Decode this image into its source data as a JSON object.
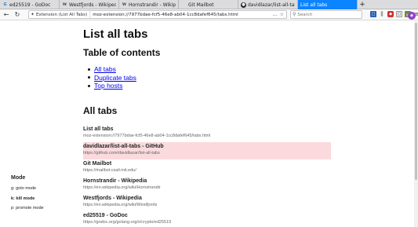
{
  "browser": {
    "tabs": [
      {
        "label": "ed25519 - GoDoc",
        "icon": "godoc-favicon-icon",
        "active": false
      },
      {
        "label": "Westfjords - Wikipedia",
        "icon": "wikipedia-favicon-icon",
        "active": false
      },
      {
        "label": "Hornstrandir - Wikipedia",
        "icon": "wikipedia-favicon-icon",
        "active": false
      },
      {
        "label": "Git Mailbot",
        "icon": "blank-favicon-icon",
        "active": false
      },
      {
        "label": "davidlazar/list-all-tabs",
        "icon": "github-favicon-icon",
        "active": false
      },
      {
        "label": "List all tabs",
        "icon": "blank-favicon-icon",
        "active": true
      }
    ],
    "new_tab_label": "+",
    "url_identity": "Extension (List All Tabs)",
    "url": "moz-extension://7977bdae-fcf5-46e8-ab04-1cc8dafef645/tabs.html",
    "url_actions": [
      "…",
      "☆"
    ],
    "search_placeholder": "Search",
    "accent_color": "#0a84ff"
  },
  "page": {
    "title": "List all tabs",
    "toc_heading": "Table of contents",
    "toc_links": [
      "All tabs",
      "Duplicate tabs",
      "Top hosts"
    ],
    "all_tabs_heading": "All tabs",
    "tab_entries": [
      {
        "title": "List all tabs",
        "url": "moz-extension://7977bdae-fcf5-46e8-ab04-1cc8dafef645/tabs.html",
        "highlighted": false
      },
      {
        "title": "davidlazar/list-all-tabs - GitHub",
        "url": "https://github.com/davidlazar/list-all-tabs",
        "highlighted": true
      },
      {
        "title": "Git Mailbot",
        "url": "https://mailbot.csail.mit.edu/",
        "highlighted": false
      },
      {
        "title": "Hornstrandir - Wikipedia",
        "url": "https://en.wikipedia.org/wiki/Hornstrandir",
        "highlighted": false
      },
      {
        "title": "Westfjords - Wikipedia",
        "url": "https://en.wikipedia.org/wiki/Westfjords",
        "highlighted": false
      },
      {
        "title": "ed25519 - GoDoc",
        "url": "https://godoc.org/golang.org/x/crypto/ed25519",
        "highlighted": false
      }
    ],
    "highlight_color": "#fadadd"
  },
  "mode_panel": {
    "heading": "Mode",
    "items": [
      {
        "label": "g: goto mode",
        "active": false
      },
      {
        "label": "k: kill mode",
        "active": true
      },
      {
        "label": "p: promote mode",
        "active": false
      }
    ]
  }
}
